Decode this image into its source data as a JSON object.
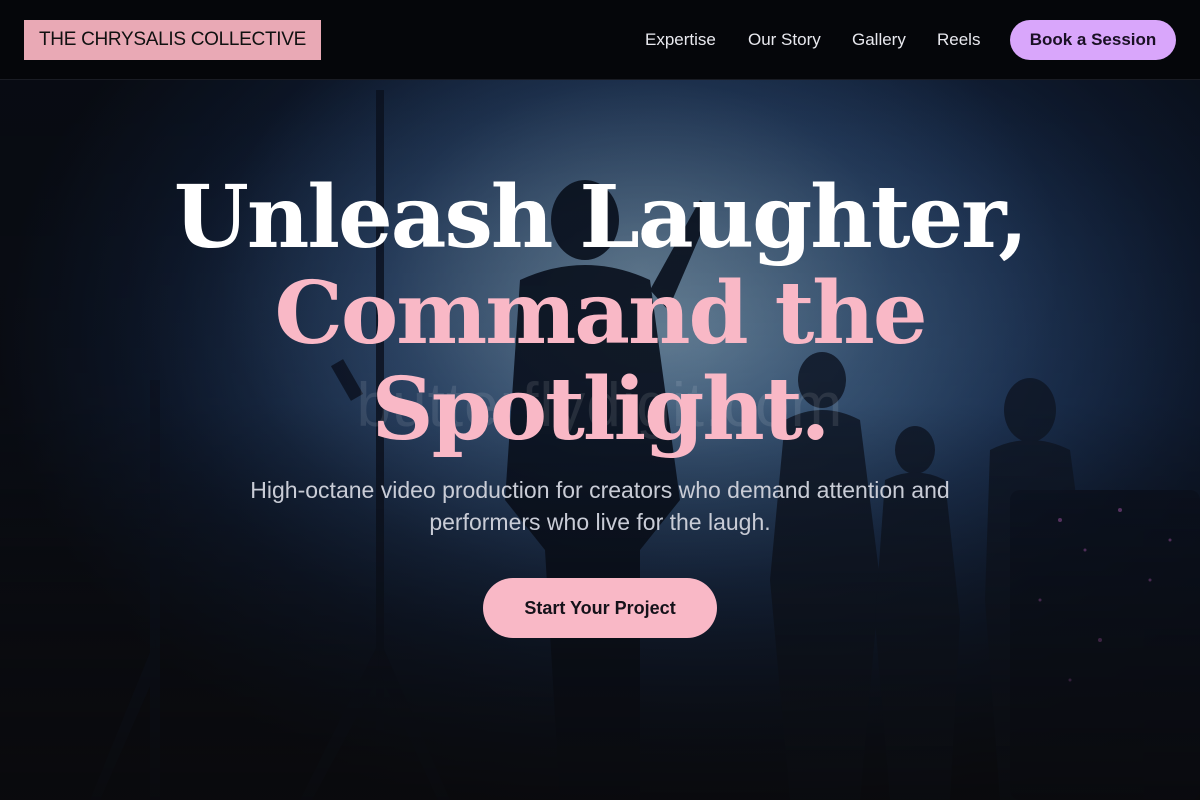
{
  "brand": {
    "name": "THE CHRYSALIS COLLECTIVE",
    "badge_color": "#e9a9b5"
  },
  "nav": {
    "links": [
      {
        "label": "Expertise"
      },
      {
        "label": "Our Story"
      },
      {
        "label": "Gallery"
      },
      {
        "label": "Reels"
      }
    ],
    "cta_label": "Book a Session",
    "cta_color": "#d9a6fb"
  },
  "hero": {
    "headline_line1": "Unleash Laughter,",
    "headline_line2a": "Command the",
    "headline_line2b": "Spotlight.",
    "subtitle": "High-octane video production for creators who demand attention and performers who live for the laugh.",
    "cta_label": "Start Your Project",
    "accent_color": "#f9b8c6",
    "background_image": "silhouetted-performers-stage-icon",
    "watermark_text": "butterflydigit.com"
  }
}
